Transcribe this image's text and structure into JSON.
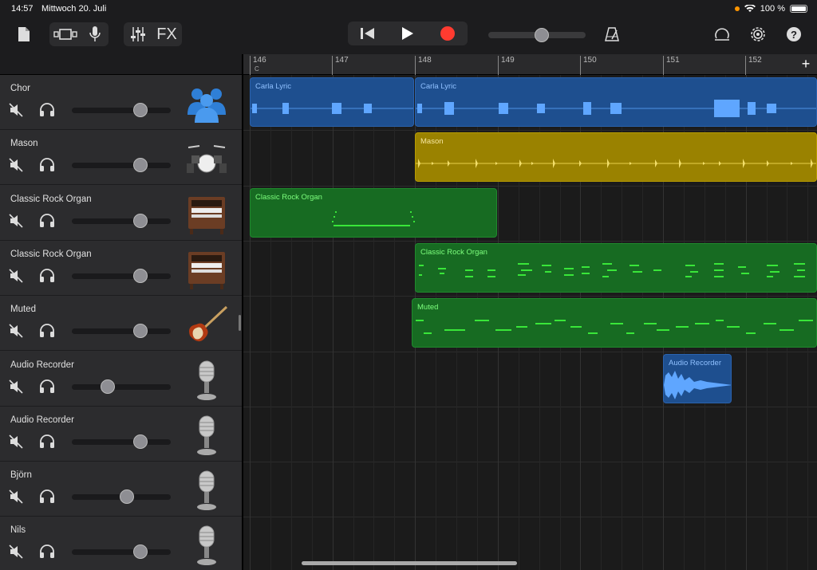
{
  "status": {
    "time": "14:57",
    "date": "Mittwoch 20. Juli",
    "battery": "100 %"
  },
  "toolbar": {
    "fx_label": "FX"
  },
  "ruler": {
    "bars": [
      "146",
      "147",
      "148",
      "149",
      "150",
      "151",
      "152"
    ],
    "key_marker": "C"
  },
  "tracks": [
    {
      "name": "Chor",
      "icon": "choir-icon",
      "volume": 0.69
    },
    {
      "name": "Mason",
      "icon": "drumkit-icon",
      "volume": 0.69
    },
    {
      "name": "Classic Rock Organ",
      "icon": "organ-icon",
      "volume": 0.69
    },
    {
      "name": "Classic Rock Organ",
      "icon": "organ-icon",
      "volume": 0.69
    },
    {
      "name": "Muted",
      "icon": "bass-guitar-icon",
      "volume": 0.69
    },
    {
      "name": "Audio Recorder",
      "icon": "microphone-icon",
      "volume": 0.36
    },
    {
      "name": "Audio Recorder",
      "icon": "microphone-icon",
      "volume": 0.69
    },
    {
      "name": "Björn",
      "icon": "microphone-icon",
      "volume": 0.56
    },
    {
      "name": "Nils",
      "icon": "microphone-icon",
      "volume": 0.69
    }
  ],
  "regions": [
    {
      "label": "Carla Lyric",
      "color": "blue"
    },
    {
      "label": "Carla Lyric",
      "color": "blue"
    },
    {
      "label": "Mason",
      "color": "yellow"
    },
    {
      "label": "Classic Rock Organ",
      "color": "green"
    },
    {
      "label": "Classic Rock Organ",
      "color": "green"
    },
    {
      "label": "Muted",
      "color": "green"
    },
    {
      "label": "Audio Recorder",
      "color": "blue"
    }
  ]
}
